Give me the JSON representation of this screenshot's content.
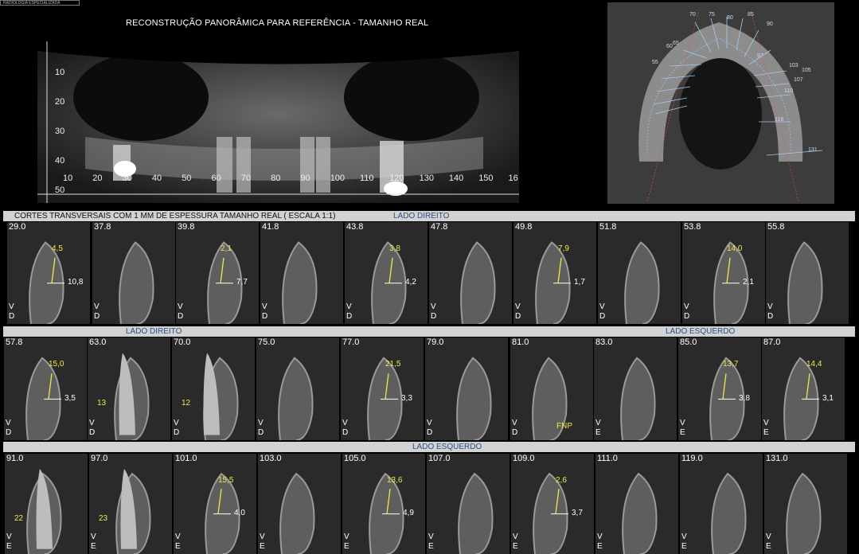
{
  "logo_text": "RADIOLOGIA ESPECIALIZADA",
  "top_title": "RECONSTRUÇÃO PANORÂMICA PARA REFERÊNCIA - TAMANHO REAL",
  "pano": {
    "x_ticks": [
      "10",
      "20",
      "30",
      "40",
      "50",
      "60",
      "70",
      "80",
      "90",
      "100",
      "110",
      "120",
      "130",
      "140",
      "150",
      "16"
    ],
    "y_ticks": [
      "10",
      "20",
      "30",
      "40",
      "50"
    ]
  },
  "axial": {
    "labels": [
      "70",
      "75",
      "80",
      "85",
      "65",
      "90",
      "60",
      "97",
      "55",
      "103",
      "105",
      "107",
      "110",
      "119",
      "131"
    ]
  },
  "band1": {
    "left": "CORTES TRANSVERSAIS COM 1 MM DE ESPESSURA TAMANHO REAL ( ESCALA 1:1)",
    "blue": "LADO DIREITO"
  },
  "band2": {
    "blue_left": "LADO DIREITO",
    "blue_right": "LADO ESQUERDO"
  },
  "band3": {
    "blue": "LADO ESQUERDO"
  },
  "row1": [
    {
      "label": "29.0",
      "top": "4,5",
      "side": "10,8",
      "o1": "V",
      "o2": "D"
    },
    {
      "label": "37.8",
      "o1": "V",
      "o2": "D"
    },
    {
      "label": "39.8",
      "top": "2,1",
      "side": "7,7",
      "o1": "V",
      "o2": "D"
    },
    {
      "label": "41.8",
      "o1": "V",
      "o2": "D"
    },
    {
      "label": "43.8",
      "top": "3,8",
      "side": "4,2",
      "o1": "V",
      "o2": "D"
    },
    {
      "label": "47.8",
      "o1": "V",
      "o2": "D"
    },
    {
      "label": "49.8",
      "top": "7,9",
      "side": "1,7",
      "o1": "V",
      "o2": "D"
    },
    {
      "label": "51.8",
      "o1": "V",
      "o2": "D"
    },
    {
      "label": "53.8",
      "top": "14,0",
      "side": "2,1",
      "o1": "V",
      "o2": "D"
    },
    {
      "label": "55.8",
      "o1": "V",
      "o2": "D"
    }
  ],
  "row2": [
    {
      "label": "57.8",
      "top": "15,0",
      "side": "3,5",
      "o1": "V",
      "o2": "D"
    },
    {
      "label": "63.0",
      "tooth": "13",
      "o1": "V",
      "o2": "D"
    },
    {
      "label": "70.0",
      "tooth": "12",
      "o1": "V",
      "o2": "D"
    },
    {
      "label": "75.0",
      "o1": "V",
      "o2": "D"
    },
    {
      "label": "77.0",
      "top": "21,5",
      "side": "3,3",
      "o1": "V",
      "o2": "D"
    },
    {
      "label": "79.0",
      "o1": "V",
      "o2": "D"
    },
    {
      "label": "81.0",
      "note": "FNP",
      "o1": "V",
      "o2": "D"
    },
    {
      "label": "83.0",
      "o1": "V",
      "o2": "E"
    },
    {
      "label": "85.0",
      "top": "13,7",
      "side": "3,8",
      "o1": "V",
      "o2": "E"
    },
    {
      "label": "87.0",
      "top": "14,4",
      "side": "3,1",
      "o1": "V",
      "o2": "E"
    }
  ],
  "row3": [
    {
      "label": "91.0",
      "tooth": "22",
      "o1": "V",
      "o2": "E"
    },
    {
      "label": "97.0",
      "tooth": "23",
      "o1": "V",
      "o2": "E"
    },
    {
      "label": "101.0",
      "top": "15,5",
      "side": "4,0",
      "o1": "V",
      "o2": "E"
    },
    {
      "label": "103.0",
      "o1": "V",
      "o2": "E"
    },
    {
      "label": "105.0",
      "top": "13,6",
      "side": "4,9",
      "o1": "V",
      "o2": "E"
    },
    {
      "label": "107.0",
      "o1": "V",
      "o2": "E"
    },
    {
      "label": "109.0",
      "top": "2,6",
      "side": "3,7",
      "o1": "V",
      "o2": "E"
    },
    {
      "label": "111.0",
      "o1": "V",
      "o2": "E"
    },
    {
      "label": "119.0",
      "o1": "V",
      "o2": "E"
    },
    {
      "label": "131.0",
      "o1": "V",
      "o2": "E"
    }
  ]
}
